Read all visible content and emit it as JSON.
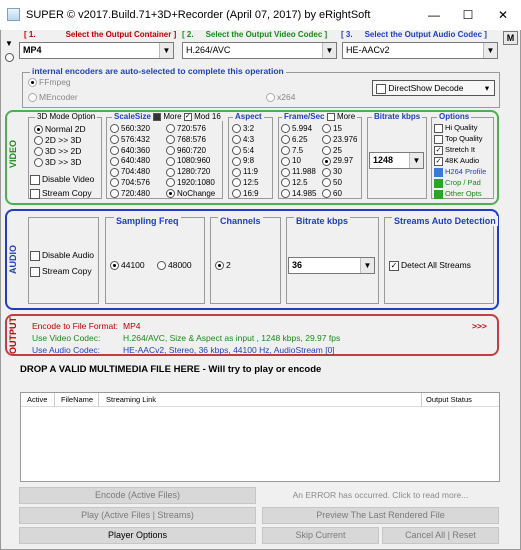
{
  "window": {
    "title": "SUPER ©  v2017.Build.71+3D+Recorder (April 07, 2017) by eRightSoft",
    "minimize": "—",
    "maximize": "☐",
    "close": "✕",
    "m_button": "M"
  },
  "step1": {
    "num": "[ 1.",
    "label": "Select the Output Container ]",
    "value": "MP4"
  },
  "step2": {
    "num": "[ 2.",
    "label": "Select the Output Video Codec ]",
    "value": "H.264/AVC"
  },
  "step3": {
    "num": "[ 3.",
    "label": "Select the Output Audio Codec ]",
    "value": "HE-AACv2"
  },
  "encoders": {
    "title": "internal encoders are auto-selected to complete this operation",
    "ffmpeg": "FFmpeg",
    "mencoder": "MEncoder",
    "x264": "x264",
    "directshow": "DirectShow Decode"
  },
  "video": {
    "side_label": "VIDEO",
    "mode3d": {
      "title": "3D Mode Option",
      "options": [
        "Normal 2D",
        "2D >> 3D",
        "3D >> 2D",
        "3D >> 3D"
      ],
      "selected": 0,
      "disable_video": "Disable Video",
      "stream_copy": "Stream Copy"
    },
    "scalesize": {
      "title": "ScaleSize",
      "more": "More",
      "mod16": "Mod 16",
      "col1": [
        "560:320",
        "576:432",
        "640:360",
        "640:480",
        "704:480",
        "704:576",
        "720:480"
      ],
      "col2": [
        "720:576",
        "768:576",
        "960:720",
        "1080:960",
        "1280:720",
        "1920:1080",
        "NoChange"
      ],
      "selected": "NoChange"
    },
    "aspect": {
      "title": "Aspect",
      "options": [
        "3:2",
        "4:3",
        "5:4",
        "9:8",
        "11:9",
        "12:5",
        "16:9"
      ]
    },
    "framerate": {
      "title": "Frame/Sec",
      "more": "More",
      "col1": [
        "5.994",
        "6.25",
        "7.5",
        "10",
        "11.988",
        "12.5",
        "14.985"
      ],
      "col2": [
        "15",
        "23.976",
        "25",
        "29.97",
        "30",
        "50",
        "60"
      ],
      "selected": "29.97"
    },
    "bitrate": {
      "title": "Bitrate  kbps",
      "value": "1248"
    },
    "options": {
      "title": "Options",
      "items": [
        "Hi Quality",
        "Top Quality",
        "Stretch It",
        "48K Audio",
        "H264 Profile",
        "Crop / Pad",
        "Other Opts"
      ]
    }
  },
  "audio": {
    "side_label": "AUDIO",
    "disable_audio": "Disable Audio",
    "stream_copy": "Stream Copy",
    "sampling": {
      "title": "Sampling Freq",
      "options": [
        "44100",
        "48000"
      ],
      "selected": "44100"
    },
    "channels": {
      "title": "Channels",
      "value": "2"
    },
    "bitrate": {
      "title": "Bitrate  kbps",
      "value": "36"
    },
    "streams": {
      "title": "Streams Auto Detection",
      "detect_all": "Detect All Streams"
    }
  },
  "output": {
    "side_label": "OUTPUT",
    "line1_label": "Encode to File Format:",
    "line1_value": "MP4",
    "line2_label": "Use Video Codec:",
    "line2_value": "H.264/AVC,  Size & Aspect as input ,  1248 kbps,  29.97 fps",
    "line3_label": "Use Audio Codec:",
    "line3_value": "HE-AACv2,  Stereo,  36 kbps,  44100 Hz,  AudioStream [0]",
    "more": ">>>"
  },
  "drop_text": "DROP A VALID MULTIMEDIA FILE HERE - Will try to play or encode",
  "filelist": {
    "col_active": "Active",
    "col_filename": "FileName",
    "col_streaming": "Streaming Link",
    "col_status": "Output Status"
  },
  "buttons": {
    "encode": "Encode (Active Files)",
    "error": "An ERROR has occurred. Click to read more...",
    "play": "Play (Active Files | Streams)",
    "preview": "Preview The Last Rendered File",
    "player_options": "Player Options",
    "skip": "Skip Current",
    "cancel": "Cancel All  |  Reset"
  }
}
